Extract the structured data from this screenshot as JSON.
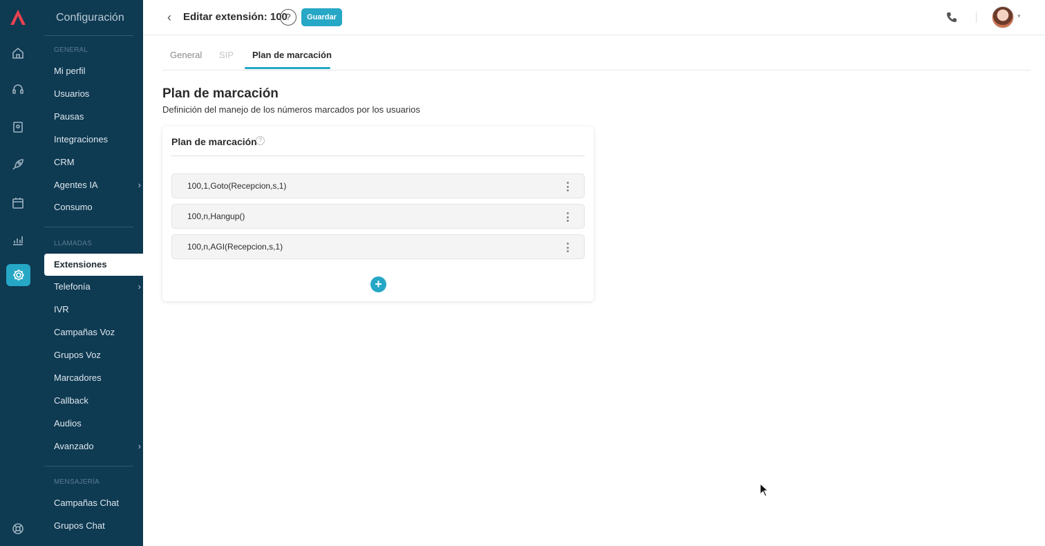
{
  "brand": {
    "accent": "#26a7c6",
    "sidebar_bg": "#0e3a52"
  },
  "sidebar": {
    "title": "Configuración",
    "sections": {
      "general": "GENERAL",
      "llamadas": "LLAMADAS",
      "mensajeria": "MENSAJERÍA"
    },
    "items": {
      "mi_perfil": "Mi perfil",
      "usuarios": "Usuarios",
      "pausas": "Pausas",
      "integraciones": "Integraciones",
      "crm": "CRM",
      "agentes_ia": "Agentes IA",
      "consumo": "Consumo",
      "extensiones": "Extensiones",
      "telefonia": "Telefonía",
      "ivr": "IVR",
      "campanas_voz": "Campañas Voz",
      "grupos_voz": "Grupos Voz",
      "marcadores": "Marcadores",
      "callback": "Callback",
      "audios": "Audios",
      "avanzado": "Avanzado",
      "campanas_chat": "Campañas Chat",
      "grupos_chat": "Grupos Chat"
    }
  },
  "header": {
    "title": "Editar extensión: 100",
    "help": "?",
    "save_label": "Guardar"
  },
  "tabs": {
    "general": "General",
    "sip": "SIP",
    "plan": "Plan de marcación"
  },
  "section": {
    "title": "Plan de marcación",
    "description": "Definición del manejo de los números marcados por los usuarios"
  },
  "card": {
    "title": "Plan de marcación",
    "help": "?",
    "rules": [
      "100,1,Goto(Recepcion,s,1)",
      "100,n,Hangup()",
      "100,n,AGI(Recepcion,s,1)"
    ],
    "add": "+"
  }
}
